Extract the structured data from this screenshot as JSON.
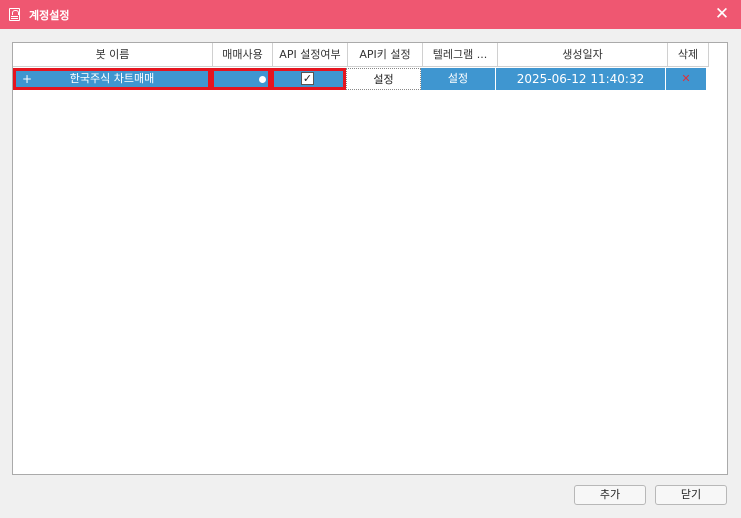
{
  "window": {
    "title": "계정설정",
    "close_symbol": "✕"
  },
  "table": {
    "columns": [
      "봇 이름",
      "매매사용",
      "API 설정여부",
      "API키 설정",
      "텔레그램 ...",
      "생성일자",
      "삭제"
    ],
    "rows": [
      {
        "expand": "+",
        "bot_name": "한국주식 차트매매",
        "trade_enabled": true,
        "api_configured": true,
        "check_mark": "✓",
        "api_key_button": "설정",
        "telegram_button": "설정",
        "created_at": "2025-06-12 11:40:32",
        "delete_symbol": "✕"
      }
    ]
  },
  "buttons": {
    "add": "추가",
    "close": "닫기"
  },
  "colors": {
    "title_bar": "#ef5771",
    "row_selected": "#3f96d0",
    "highlight_border": "#e5141e",
    "delete": "#e0303a"
  }
}
